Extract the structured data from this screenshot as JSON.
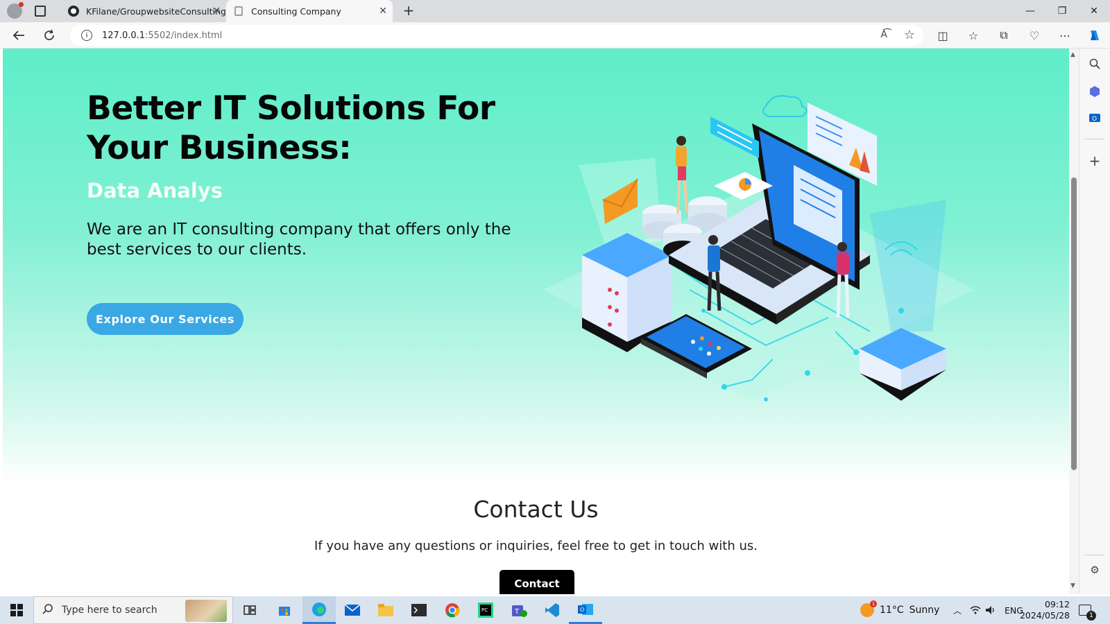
{
  "browser": {
    "tabs": [
      {
        "label": "KFilane/GroupwebsiteConsulting",
        "active": false
      },
      {
        "label": "Consulting Company",
        "active": true
      }
    ],
    "url": "127.0.0.1:5502/index.html",
    "url_host": "127.0.0.1",
    "url_rest": ":5502/index.html"
  },
  "hero": {
    "title": "Better IT Solutions For Your Business:",
    "subtitle": "Data Analys",
    "description": "We are an IT consulting company that offers only the best services to our clients.",
    "cta_label": "Explore Our Services"
  },
  "contact": {
    "heading": "Contact Us",
    "text": "If you have any questions or inquiries, feel free to get in touch with us.",
    "button_label": "Contact"
  },
  "taskbar": {
    "search_placeholder": "Type here to search",
    "weather_temp": "11°C",
    "weather_text": "Sunny",
    "language": "ENG",
    "time": "09:12",
    "date": "2024/05/28",
    "notification_count": "1"
  },
  "colors": {
    "accent": "#3aa8e4",
    "hero_bg": "#5eeec9",
    "taskbar": "#d9e4ef"
  }
}
